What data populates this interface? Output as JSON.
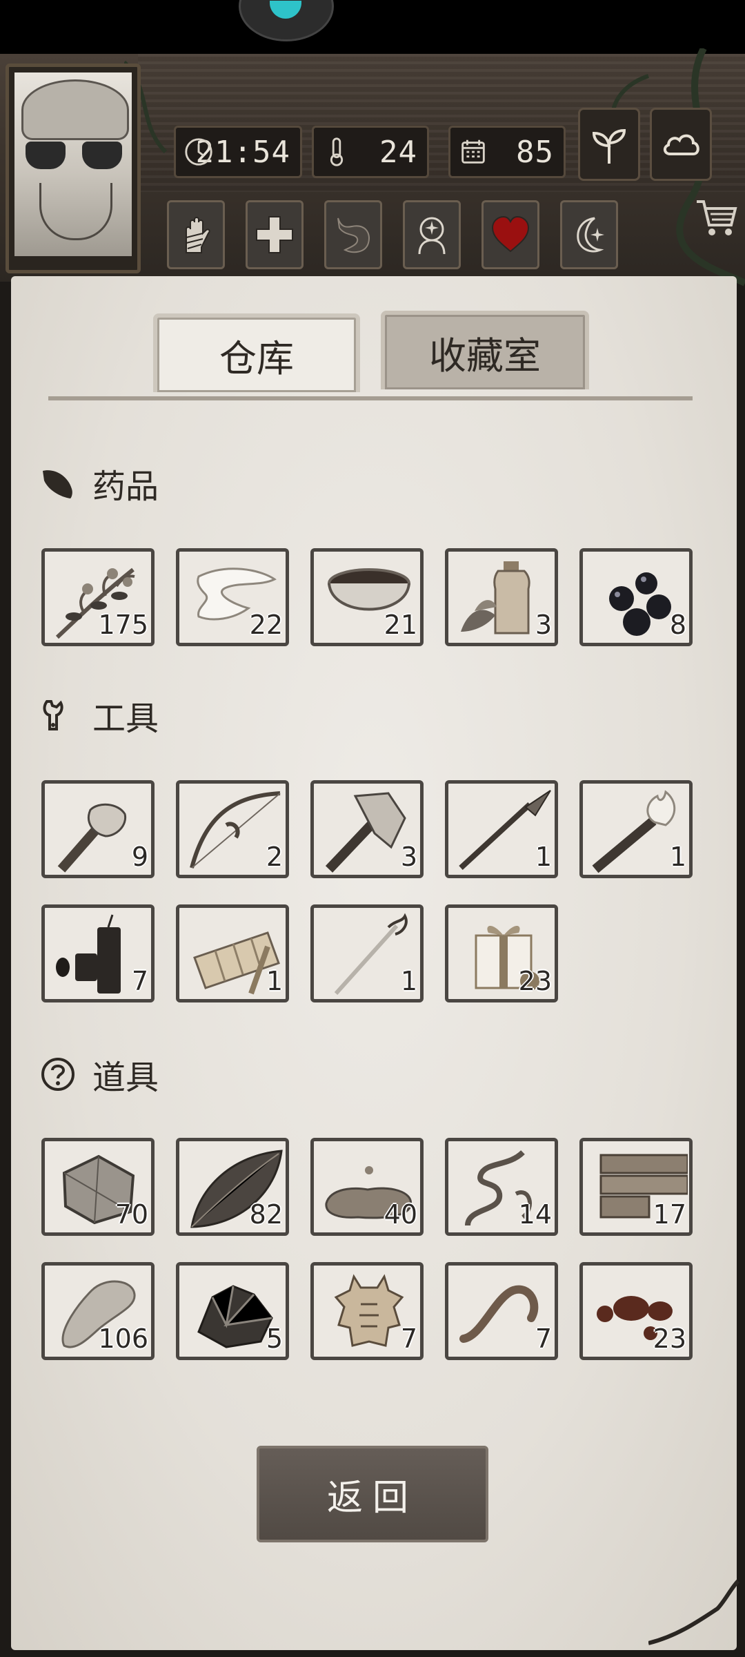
{
  "status": {
    "time": "21:54",
    "temperature": "24",
    "day": "85"
  },
  "header_buttons": [
    "sprout-icon",
    "cloud-icon"
  ],
  "status_icons": [
    "bandaged-hand-icon",
    "medical-cross-icon",
    "stomach-icon",
    "head-icon",
    "heart-icon",
    "moon-star-icon"
  ],
  "tabs": {
    "warehouse": "仓库",
    "collection": "收藏室"
  },
  "sections": {
    "medicine": {
      "title": "药品",
      "items": [
        {
          "icon": "herb-branch-icon",
          "count": "175"
        },
        {
          "icon": "bandage-icon",
          "count": "22"
        },
        {
          "icon": "soup-bowl-icon",
          "count": "21"
        },
        {
          "icon": "medicine-bottle-icon",
          "count": "3"
        },
        {
          "icon": "berries-icon",
          "count": "8"
        }
      ]
    },
    "tools": {
      "title": "工具",
      "items": [
        {
          "icon": "stone-hammer-icon",
          "count": "9"
        },
        {
          "icon": "bow-icon",
          "count": "2"
        },
        {
          "icon": "axe-icon",
          "count": "3"
        },
        {
          "icon": "spear-icon",
          "count": "1"
        },
        {
          "icon": "torch-icon",
          "count": "1"
        },
        {
          "icon": "dynamite-icon",
          "count": "7"
        },
        {
          "icon": "flashlight-icon",
          "count": "1"
        },
        {
          "icon": "sword-icon",
          "count": "1"
        },
        {
          "icon": "gift-box-icon",
          "count": "23"
        }
      ]
    },
    "props": {
      "title": "道具",
      "items": [
        {
          "icon": "rock-icon",
          "count": "70"
        },
        {
          "icon": "leaf-icon",
          "count": "82"
        },
        {
          "icon": "puddle-icon",
          "count": "40"
        },
        {
          "icon": "vine-icon",
          "count": "14"
        },
        {
          "icon": "wood-planks-icon",
          "count": "17"
        },
        {
          "icon": "stone-chunk-icon",
          "count": "106"
        },
        {
          "icon": "ore-icon",
          "count": "5"
        },
        {
          "icon": "animal-hide-icon",
          "count": "7"
        },
        {
          "icon": "worm-icon",
          "count": "7"
        },
        {
          "icon": "blood-drops-icon",
          "count": "23"
        }
      ]
    }
  },
  "back_label": "返回"
}
